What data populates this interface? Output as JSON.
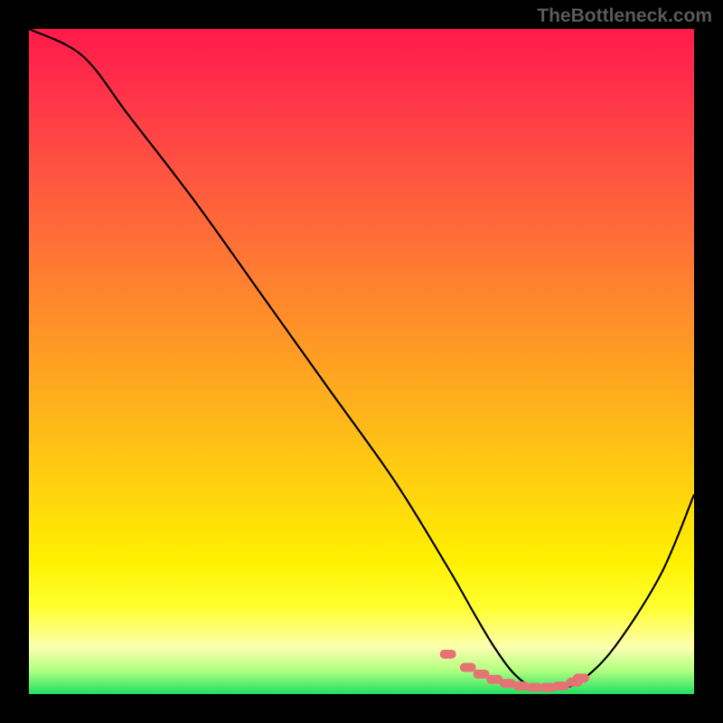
{
  "watermark": "TheBottleneck.com",
  "chart_data": {
    "type": "line",
    "title": "",
    "xlabel": "",
    "ylabel": "",
    "xlim": [
      0,
      100
    ],
    "ylim": [
      0,
      100
    ],
    "series": [
      {
        "name": "bottleneck-curve",
        "x": [
          0,
          8,
          15,
          25,
          35,
          45,
          55,
          63,
          67,
          70,
          73,
          76,
          80,
          83,
          88,
          95,
          100
        ],
        "values": [
          100,
          96,
          87,
          74,
          60,
          46,
          32,
          19,
          12,
          7,
          3,
          1,
          1,
          2,
          7,
          18,
          30
        ]
      }
    ],
    "markers": {
      "name": "highlight-segment",
      "color": "#e57373",
      "x": [
        63,
        66,
        68,
        70,
        72,
        74,
        76,
        78,
        80,
        82,
        83
      ],
      "values": [
        6,
        4,
        3,
        2.2,
        1.6,
        1.2,
        1.0,
        1.0,
        1.2,
        1.8,
        2.4
      ]
    },
    "gradient_stops": [
      {
        "pos": 0.0,
        "color": "#ff1a4a"
      },
      {
        "pos": 0.5,
        "color": "#ffa520"
      },
      {
        "pos": 0.85,
        "color": "#ffff30"
      },
      {
        "pos": 1.0,
        "color": "#20e060"
      }
    ]
  }
}
